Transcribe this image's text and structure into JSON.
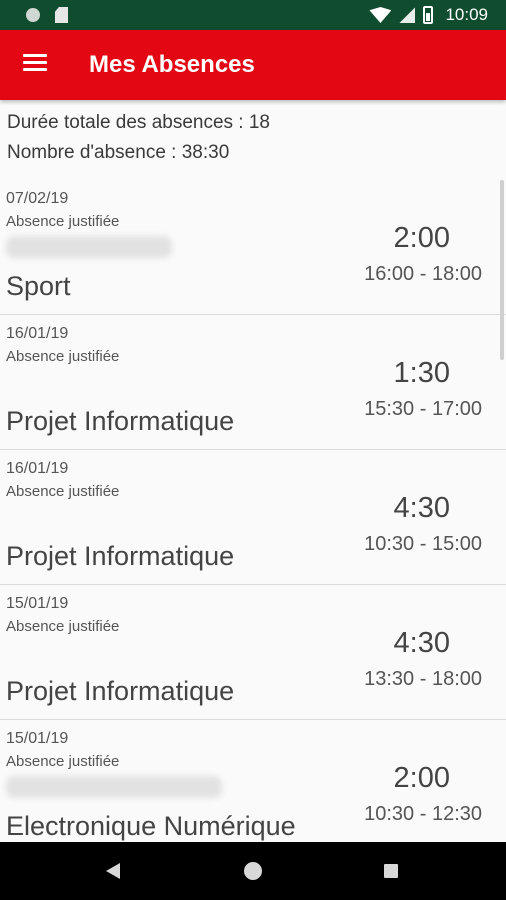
{
  "status_bar": {
    "time": "10:09"
  },
  "app_bar": {
    "title": "Mes Absences"
  },
  "summary": {
    "total_duration": "Durée totale des absences : 18",
    "absence_count": "Nombre d'absence : 38:30"
  },
  "absences": [
    {
      "date": "07/02/19",
      "status": "Absence justifiée",
      "subject": "Sport",
      "duration": "2:00",
      "range": "16:00 - 18:00"
    },
    {
      "date": "16/01/19",
      "status": "Absence justifiée",
      "subject": "Projet Informatique",
      "duration": "1:30",
      "range": "15:30 - 17:00"
    },
    {
      "date": "16/01/19",
      "status": "Absence justifiée",
      "subject": "Projet Informatique",
      "duration": "4:30",
      "range": "10:30 - 15:00"
    },
    {
      "date": "15/01/19",
      "status": "Absence justifiée",
      "subject": "Projet Informatique",
      "duration": "4:30",
      "range": "13:30 - 18:00"
    },
    {
      "date": "15/01/19",
      "status": "Absence justifiée",
      "subject": "Electronique Numérique",
      "duration": "2:00",
      "range": "10:30 - 12:30"
    }
  ],
  "colors": {
    "app_bar": "#e30613",
    "status_bar": "#0f4d2e"
  },
  "icons": {
    "menu": "hamburger-menu-icon",
    "nav_back": "back-triangle-icon",
    "nav_home": "home-circle-icon",
    "nav_recent": "recent-apps-square-icon"
  }
}
